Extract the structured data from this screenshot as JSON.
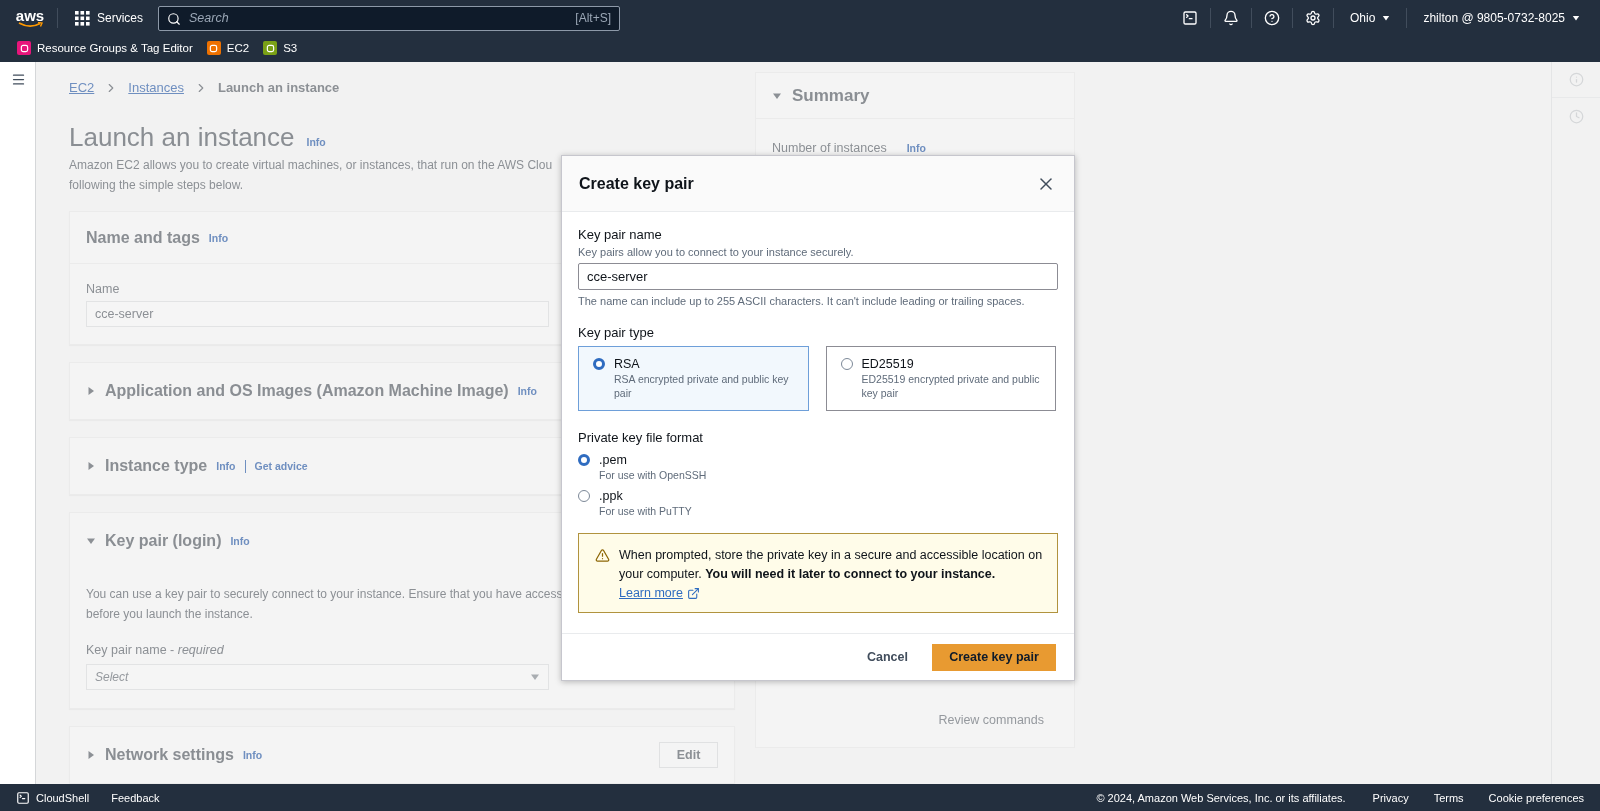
{
  "top_nav": {
    "logo": "aws",
    "services_label": "Services",
    "search": {
      "placeholder": "Search",
      "shortcut": "[Alt+S]"
    },
    "region": "Ohio",
    "account": "zhilton @ 9805-0732-8025"
  },
  "favorites": [
    {
      "label": "Resource Groups & Tag Editor",
      "color": "#e7157b"
    },
    {
      "label": "EC2",
      "color": "#ed7100"
    },
    {
      "label": "S3",
      "color": "#7aa116"
    }
  ],
  "breadcrumbs": [
    {
      "label": "EC2",
      "current": false
    },
    {
      "label": "Instances",
      "current": false
    },
    {
      "label": "Launch an instance",
      "current": true
    }
  ],
  "page": {
    "title": "Launch an instance",
    "info": "Info",
    "description_lines": [
      "Amazon EC2 allows you to create virtual machines, or instances, that run on the AWS Clou",
      "following the simple steps below."
    ]
  },
  "sections": [
    {
      "kind": "name",
      "title": "Name and tags",
      "info": "Info",
      "field_label": "Name",
      "value": "cce-server"
    },
    {
      "kind": "plain",
      "title": "Application and OS Images (Amazon Machine Image)",
      "info": "Info",
      "expanded": false
    },
    {
      "kind": "plain",
      "title": "Instance type",
      "info": "Info",
      "extra_link": "Get advice",
      "expanded": false
    },
    {
      "kind": "key_pair",
      "title": "Key pair (login)",
      "info": "Info",
      "expanded": true,
      "description_lines": [
        "You can use a key pair to securely connect to your instance. Ensure that you have access",
        "before you launch the instance."
      ],
      "field_label": "Key pair name - *required*",
      "placeholder": "Select"
    },
    {
      "kind": "plain",
      "title": "Network settings",
      "info": "Info",
      "expanded": false,
      "action": "Edit"
    }
  ],
  "summary": {
    "title": "Summary",
    "expanded": true,
    "number_label": "Number of instances",
    "info": "Info",
    "review_link": "Review commands"
  },
  "modal": {
    "title": "Create key pair",
    "name_label": "Key pair name",
    "name_description": "Key pairs allow you to connect to your instance securely.",
    "name_value": "cce-server",
    "name_constraint": "The name can include up to 255 ASCII characters. It can't include leading or trailing spaces.",
    "type_label": "Key pair type",
    "key_types": [
      {
        "label": "RSA",
        "description": "RSA encrypted private and public key pair",
        "selected": true
      },
      {
        "label": "ED25519",
        "description": "ED25519 encrypted private and public key pair",
        "selected": false
      }
    ],
    "format_label": "Private key file format",
    "formats": [
      {
        "label": ".pem",
        "description": "For use with OpenSSH",
        "selected": true
      },
      {
        "label": ".ppk",
        "description": "For use with PuTTY",
        "selected": false
      }
    ],
    "alert": {
      "text": "When prompted, store the private key in a secure and accessible location on your computer. **You will need it later to connect to your instance.**",
      "link": "Learn more"
    },
    "cancel": "Cancel",
    "submit": "Create key pair"
  },
  "footer": {
    "cloudshell": "CloudShell",
    "feedback": "Feedback",
    "copyright": "© 2024, Amazon Web Services, Inc. or its affiliates.",
    "links": [
      "Privacy",
      "Terms",
      "Cookie preferences"
    ]
  }
}
